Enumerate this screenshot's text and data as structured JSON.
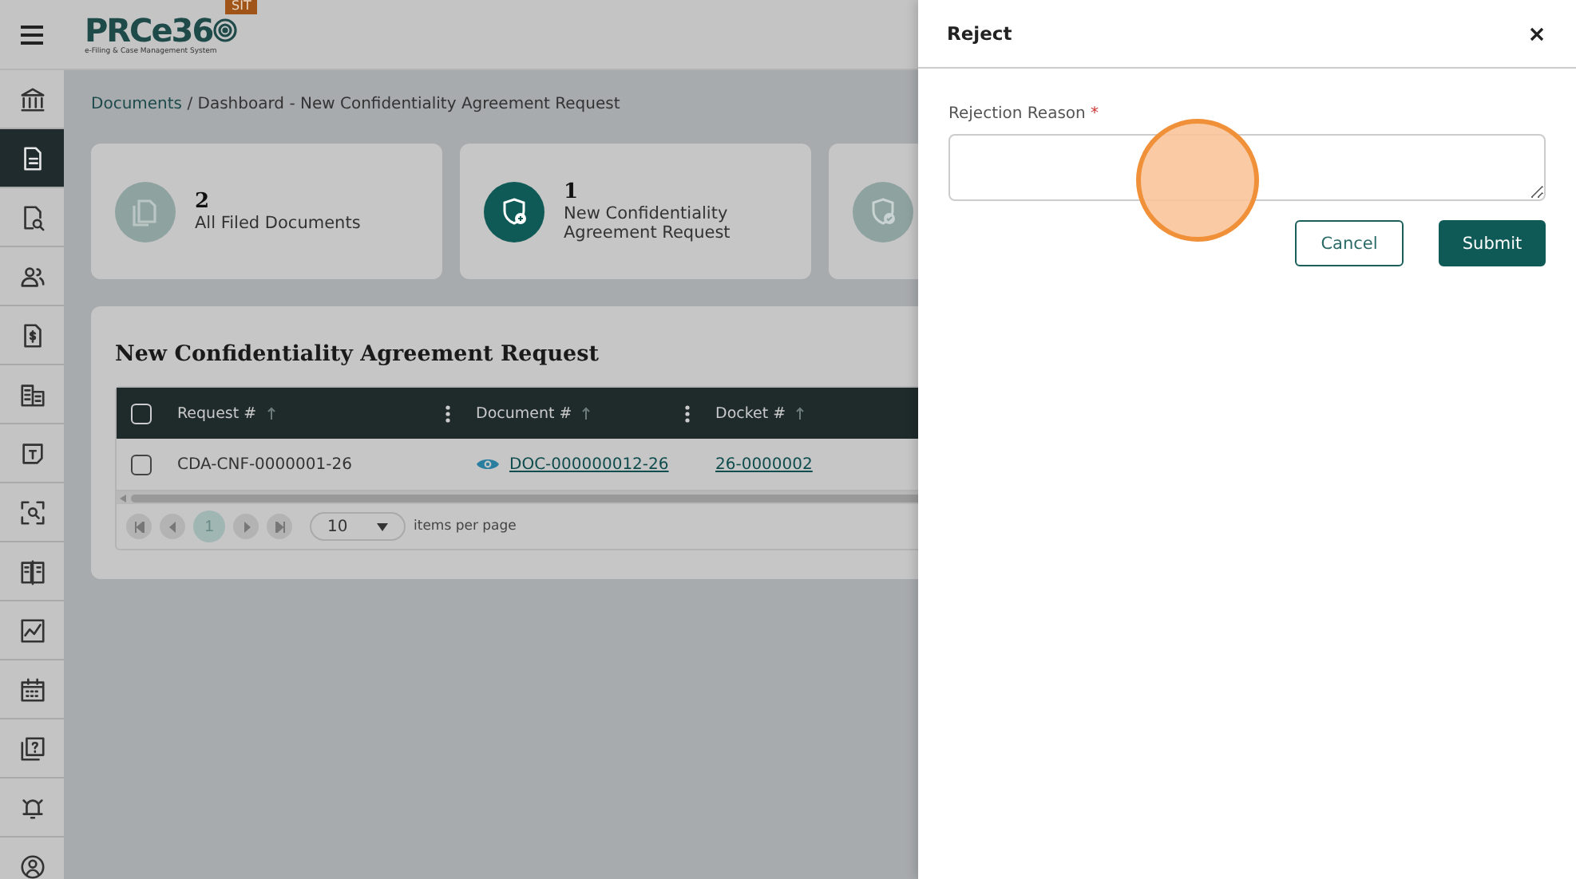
{
  "header": {
    "logo": "PRCe36",
    "logo_subtitle": "e-Filing & Case Management System",
    "env_badge": "SIT"
  },
  "sidebar": {
    "items": [
      {
        "kind": "bank",
        "selected": false
      },
      {
        "kind": "document",
        "selected": true
      },
      {
        "kind": "doc-search",
        "selected": false
      },
      {
        "kind": "people",
        "selected": false
      },
      {
        "kind": "invoice",
        "selected": false
      },
      {
        "kind": "building",
        "selected": false
      },
      {
        "kind": "note",
        "selected": false
      },
      {
        "kind": "scan",
        "selected": false
      },
      {
        "kind": "book",
        "selected": false
      },
      {
        "kind": "chart",
        "selected": false
      },
      {
        "kind": "calendar",
        "selected": false
      },
      {
        "kind": "help",
        "selected": false
      },
      {
        "kind": "bell",
        "selected": false
      },
      {
        "kind": "user",
        "selected": false
      }
    ]
  },
  "breadcrumb": [
    {
      "label": "Documents",
      "link": true
    },
    {
      "label": " / Dashboard - New Confidentiality Agreement Request",
      "link": false
    }
  ],
  "cards": [
    {
      "kind": "files",
      "count": "2",
      "label": "All Filed Documents",
      "selected": false
    },
    {
      "kind": "shield-plus",
      "count": "1",
      "label": "New Confidentiality Agreement Request",
      "selected": true
    },
    {
      "kind": "shield-check",
      "selected": false
    }
  ],
  "table": {
    "title": "New Confidentiality Agreement Request",
    "select_all_checked": false,
    "columns": [
      "Request #",
      "Document #",
      "Docket #"
    ],
    "rows": [
      {
        "checked": false,
        "cells": [
          "CDA-CNF-0000001-26",
          "DOC-000000012-26",
          "26-0000002"
        ]
      }
    ],
    "pager": {
      "pages": [
        {
          "label": "1",
          "selected": true
        }
      ],
      "page_size": "10",
      "page_size_label": "items per page"
    }
  },
  "drawer": {
    "title": "Reject",
    "field": {
      "label": "Rejection Reason",
      "required_mark": "*"
    },
    "buttons": [
      {
        "label": "Cancel",
        "kind": "secondary"
      },
      {
        "label": "Submit",
        "kind": "primary"
      }
    ]
  }
}
